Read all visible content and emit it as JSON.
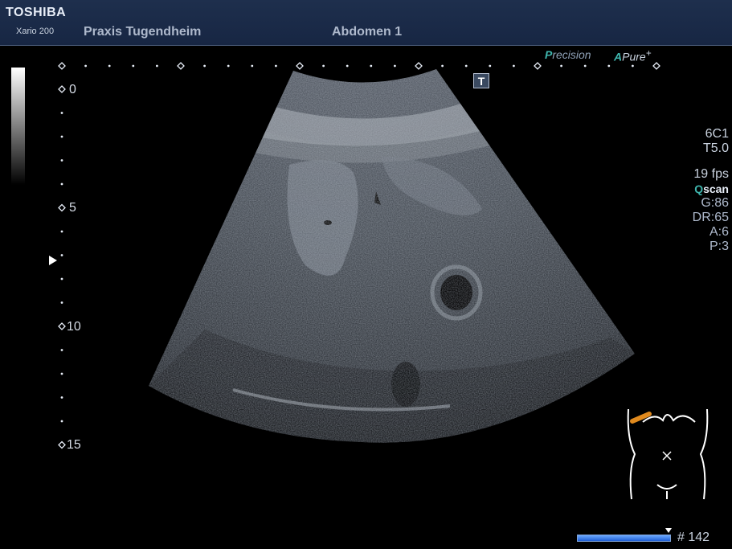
{
  "header": {
    "brand": "TOSHIBA",
    "model": "Xario 200",
    "facility": "Praxis Tugendheim",
    "exam": "Abdomen 1"
  },
  "badges": {
    "precision_first": "P",
    "precision_rest": "recision",
    "apure_first": "A",
    "apure_rest": "Pure",
    "apure_plus": "+"
  },
  "transducer_marker": "T",
  "depth_scale": {
    "labels": [
      "0",
      "5",
      "10",
      "15"
    ]
  },
  "parameters": {
    "probe": "6C1",
    "frequency": "T5.0",
    "frame_rate": "19 fps",
    "qscan_q": "Q",
    "qscan_rest": "scan",
    "gain": "G:86",
    "dynamic_range": "DR:65",
    "a_value": "A:6",
    "p_value": "P:3"
  },
  "cine": {
    "frame_label": "# 142"
  },
  "colors": {
    "header_bg": "#1e2f4d",
    "accent_teal": "#3fb6ae",
    "probe_mark": "#e08a1e",
    "cine_bar": "#2f74e8"
  }
}
